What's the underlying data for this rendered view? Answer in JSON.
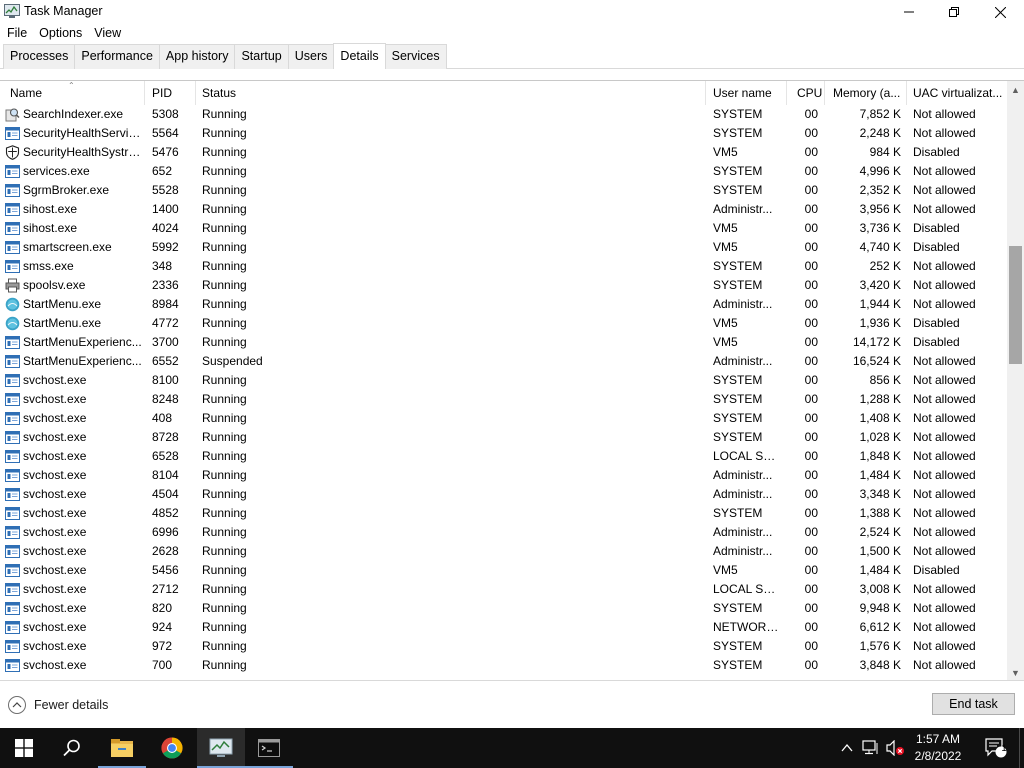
{
  "window": {
    "title": "Task Manager",
    "minimize_label": "Minimize",
    "maximize_label": "Restore",
    "close_label": "Close"
  },
  "menu": [
    "File",
    "Options",
    "View"
  ],
  "tabs": [
    {
      "label": "Processes",
      "active": false
    },
    {
      "label": "Performance",
      "active": false
    },
    {
      "label": "App history",
      "active": false
    },
    {
      "label": "Startup",
      "active": false
    },
    {
      "label": "Users",
      "active": false
    },
    {
      "label": "Details",
      "active": true
    },
    {
      "label": "Services",
      "active": false
    }
  ],
  "columns": {
    "name": "Name",
    "pid": "PID",
    "status": "Status",
    "user": "User name",
    "cpu": "CPU",
    "memory": "Memory (a...",
    "uac": "UAC virtualizat..."
  },
  "rows": [
    {
      "icon": "search-indexer-icon",
      "name": "SearchIndexer.exe",
      "pid": "5308",
      "status": "Running",
      "user": "SYSTEM",
      "cpu": "00",
      "memory": "7,852 K",
      "uac": "Not allowed"
    },
    {
      "icon": "window-app-icon",
      "name": "SecurityHealthServic...",
      "pid": "5564",
      "status": "Running",
      "user": "SYSTEM",
      "cpu": "00",
      "memory": "2,248 K",
      "uac": "Not allowed"
    },
    {
      "icon": "shield-icon",
      "name": "SecurityHealthSystra...",
      "pid": "5476",
      "status": "Running",
      "user": "VM5",
      "cpu": "00",
      "memory": "984 K",
      "uac": "Disabled"
    },
    {
      "icon": "window-app-icon",
      "name": "services.exe",
      "pid": "652",
      "status": "Running",
      "user": "SYSTEM",
      "cpu": "00",
      "memory": "4,996 K",
      "uac": "Not allowed"
    },
    {
      "icon": "window-app-icon",
      "name": "SgrmBroker.exe",
      "pid": "5528",
      "status": "Running",
      "user": "SYSTEM",
      "cpu": "00",
      "memory": "2,352 K",
      "uac": "Not allowed"
    },
    {
      "icon": "window-app-icon",
      "name": "sihost.exe",
      "pid": "1400",
      "status": "Running",
      "user": "Administr...",
      "cpu": "00",
      "memory": "3,956 K",
      "uac": "Not allowed"
    },
    {
      "icon": "window-app-icon",
      "name": "sihost.exe",
      "pid": "4024",
      "status": "Running",
      "user": "VM5",
      "cpu": "00",
      "memory": "3,736 K",
      "uac": "Disabled"
    },
    {
      "icon": "window-app-icon",
      "name": "smartscreen.exe",
      "pid": "5992",
      "status": "Running",
      "user": "VM5",
      "cpu": "00",
      "memory": "4,740 K",
      "uac": "Disabled"
    },
    {
      "icon": "window-app-icon",
      "name": "smss.exe",
      "pid": "348",
      "status": "Running",
      "user": "SYSTEM",
      "cpu": "00",
      "memory": "252 K",
      "uac": "Not allowed"
    },
    {
      "icon": "printer-icon",
      "name": "spoolsv.exe",
      "pid": "2336",
      "status": "Running",
      "user": "SYSTEM",
      "cpu": "00",
      "memory": "3,420 K",
      "uac": "Not allowed"
    },
    {
      "icon": "start-menu-icon",
      "name": "StartMenu.exe",
      "pid": "8984",
      "status": "Running",
      "user": "Administr...",
      "cpu": "00",
      "memory": "1,944 K",
      "uac": "Not allowed"
    },
    {
      "icon": "start-menu-icon",
      "name": "StartMenu.exe",
      "pid": "4772",
      "status": "Running",
      "user": "VM5",
      "cpu": "00",
      "memory": "1,936 K",
      "uac": "Disabled"
    },
    {
      "icon": "window-app-icon",
      "name": "StartMenuExperienc...",
      "pid": "3700",
      "status": "Running",
      "user": "VM5",
      "cpu": "00",
      "memory": "14,172 K",
      "uac": "Disabled"
    },
    {
      "icon": "window-app-icon",
      "name": "StartMenuExperienc...",
      "pid": "6552",
      "status": "Suspended",
      "user": "Administr...",
      "cpu": "00",
      "memory": "16,524 K",
      "uac": "Not allowed"
    },
    {
      "icon": "window-app-icon",
      "name": "svchost.exe",
      "pid": "8100",
      "status": "Running",
      "user": "SYSTEM",
      "cpu": "00",
      "memory": "856 K",
      "uac": "Not allowed"
    },
    {
      "icon": "window-app-icon",
      "name": "svchost.exe",
      "pid": "8248",
      "status": "Running",
      "user": "SYSTEM",
      "cpu": "00",
      "memory": "1,288 K",
      "uac": "Not allowed"
    },
    {
      "icon": "window-app-icon",
      "name": "svchost.exe",
      "pid": "408",
      "status": "Running",
      "user": "SYSTEM",
      "cpu": "00",
      "memory": "1,408 K",
      "uac": "Not allowed"
    },
    {
      "icon": "window-app-icon",
      "name": "svchost.exe",
      "pid": "8728",
      "status": "Running",
      "user": "SYSTEM",
      "cpu": "00",
      "memory": "1,028 K",
      "uac": "Not allowed"
    },
    {
      "icon": "window-app-icon",
      "name": "svchost.exe",
      "pid": "6528",
      "status": "Running",
      "user": "LOCAL SE...",
      "cpu": "00",
      "memory": "1,848 K",
      "uac": "Not allowed"
    },
    {
      "icon": "window-app-icon",
      "name": "svchost.exe",
      "pid": "8104",
      "status": "Running",
      "user": "Administr...",
      "cpu": "00",
      "memory": "1,484 K",
      "uac": "Not allowed"
    },
    {
      "icon": "window-app-icon",
      "name": "svchost.exe",
      "pid": "4504",
      "status": "Running",
      "user": "Administr...",
      "cpu": "00",
      "memory": "3,348 K",
      "uac": "Not allowed"
    },
    {
      "icon": "window-app-icon",
      "name": "svchost.exe",
      "pid": "4852",
      "status": "Running",
      "user": "SYSTEM",
      "cpu": "00",
      "memory": "1,388 K",
      "uac": "Not allowed"
    },
    {
      "icon": "window-app-icon",
      "name": "svchost.exe",
      "pid": "6996",
      "status": "Running",
      "user": "Administr...",
      "cpu": "00",
      "memory": "2,524 K",
      "uac": "Not allowed"
    },
    {
      "icon": "window-app-icon",
      "name": "svchost.exe",
      "pid": "2628",
      "status": "Running",
      "user": "Administr...",
      "cpu": "00",
      "memory": "1,500 K",
      "uac": "Not allowed"
    },
    {
      "icon": "window-app-icon",
      "name": "svchost.exe",
      "pid": "5456",
      "status": "Running",
      "user": "VM5",
      "cpu": "00",
      "memory": "1,484 K",
      "uac": "Disabled"
    },
    {
      "icon": "window-app-icon",
      "name": "svchost.exe",
      "pid": "2712",
      "status": "Running",
      "user": "LOCAL SE...",
      "cpu": "00",
      "memory": "3,008 K",
      "uac": "Not allowed"
    },
    {
      "icon": "window-app-icon",
      "name": "svchost.exe",
      "pid": "820",
      "status": "Running",
      "user": "SYSTEM",
      "cpu": "00",
      "memory": "9,948 K",
      "uac": "Not allowed"
    },
    {
      "icon": "window-app-icon",
      "name": "svchost.exe",
      "pid": "924",
      "status": "Running",
      "user": "NETWORK...",
      "cpu": "00",
      "memory": "6,612 K",
      "uac": "Not allowed"
    },
    {
      "icon": "window-app-icon",
      "name": "svchost.exe",
      "pid": "972",
      "status": "Running",
      "user": "SYSTEM",
      "cpu": "00",
      "memory": "1,576 K",
      "uac": "Not allowed"
    },
    {
      "icon": "window-app-icon",
      "name": "svchost.exe",
      "pid": "700",
      "status": "Running",
      "user": "SYSTEM",
      "cpu": "00",
      "memory": "3,848 K",
      "uac": "Not allowed"
    }
  ],
  "footer": {
    "fewer_details": "Fewer details",
    "end_task": "End task"
  },
  "taskbar": {
    "time": "1:57 AM",
    "date": "2/8/2022",
    "notification_count": "1"
  }
}
